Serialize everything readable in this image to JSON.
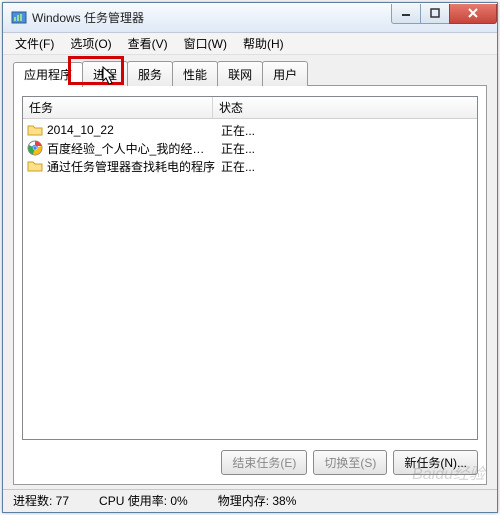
{
  "titlebar": {
    "title": "Windows 任务管理器"
  },
  "menu": {
    "file": "文件(F)",
    "options": "选项(O)",
    "view": "查看(V)",
    "window": "窗口(W)",
    "help": "帮助(H)"
  },
  "tabs": {
    "applications": "应用程序",
    "processes": "进程",
    "services": "服务",
    "performance": "性能",
    "networking": "联网",
    "users": "用户"
  },
  "columns": {
    "task": "任务",
    "status": "状态"
  },
  "rows": [
    {
      "icon": "folder-icon",
      "task": "2014_10_22",
      "status": "正在..."
    },
    {
      "icon": "chrome-icon",
      "task": "百度经验_个人中心_我的经验 -...",
      "status": "正在..."
    },
    {
      "icon": "folder-icon",
      "task": "通过任务管理器查找耗电的程序",
      "status": "正在..."
    }
  ],
  "buttons": {
    "end_task": "结束任务(E)",
    "switch_to": "切换至(S)",
    "new_task": "新任务(N)..."
  },
  "statusbar": {
    "processes": "进程数: 77",
    "cpu": "CPU 使用率: 0%",
    "memory": "物理内存: 38%"
  },
  "watermark": "Baidu经验"
}
